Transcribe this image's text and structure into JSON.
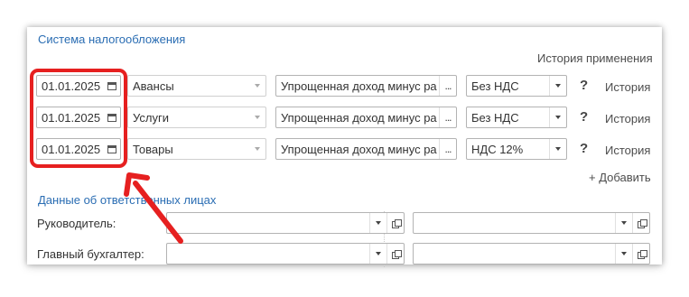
{
  "tax_section": {
    "title": "Система налогообложения",
    "history_link": "История применения",
    "rows": [
      {
        "date": "01.01.2025",
        "type": "Авансы",
        "system": "Упрощенная доход минус ра",
        "vat": "Без НДС",
        "help": "?",
        "history": "История"
      },
      {
        "date": "01.01.2025",
        "type": "Услуги",
        "system": "Упрощенная доход минус ра",
        "vat": "Без НДС",
        "help": "?",
        "history": "История"
      },
      {
        "date": "01.01.2025",
        "type": "Товары",
        "system": "Упрощенная доход минус ра",
        "vat": "НДС 12%",
        "help": "?",
        "history": "История"
      }
    ],
    "add_label": "+ Добавить",
    "system_button": "..."
  },
  "responsible_section": {
    "title": "Данные об ответственных лицах",
    "rows": [
      {
        "label": "Руководитель:",
        "left_value": "",
        "right_value": ""
      },
      {
        "label": "Главный бухгалтер:",
        "left_value": "",
        "right_value": ""
      }
    ]
  },
  "icons": {
    "date_picker": "calendar-icon",
    "dropdown": "chevron-down-icon",
    "open": "open-form-icon"
  },
  "colors": {
    "section_title": "#2a6db3",
    "highlight_annotation": "#e62020"
  }
}
